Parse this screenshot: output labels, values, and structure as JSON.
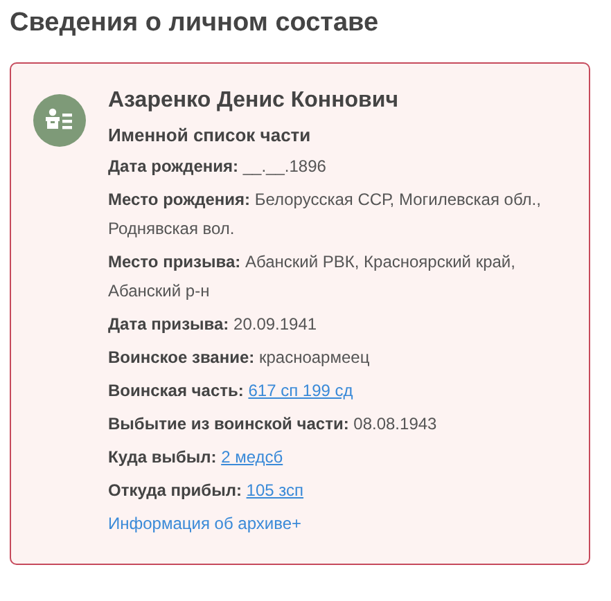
{
  "heading": "Сведения о личном составе",
  "card": {
    "name": "Азаренко Денис Коннович",
    "source": "Именной список части",
    "fields": [
      {
        "label": "Дата рождения:",
        "value": "__.__.1896",
        "kind": "text"
      },
      {
        "label": "Место рождения:",
        "value": "Белорусская ССР, Могилевская обл., Роднявская вол.",
        "kind": "text"
      },
      {
        "label": "Место призыва:",
        "value": "Абанский РВК, Красноярский край, Абанский р-н",
        "kind": "text"
      },
      {
        "label": "Дата призыва:",
        "value": "20.09.1941",
        "kind": "text"
      },
      {
        "label": "Воинское звание:",
        "value": "красноармеец",
        "kind": "text"
      },
      {
        "label": "Воинская часть:",
        "value": "617 сп 199 сд",
        "kind": "link"
      },
      {
        "label": "Выбытие из воинской части:",
        "value": "08.08.1943",
        "kind": "text"
      },
      {
        "label": "Куда выбыл:",
        "value": "2 медсб",
        "kind": "link"
      },
      {
        "label": "Откуда прибыл:",
        "value": "105 зсп",
        "kind": "link"
      }
    ],
    "archive_link": "Информация об архиве+"
  }
}
